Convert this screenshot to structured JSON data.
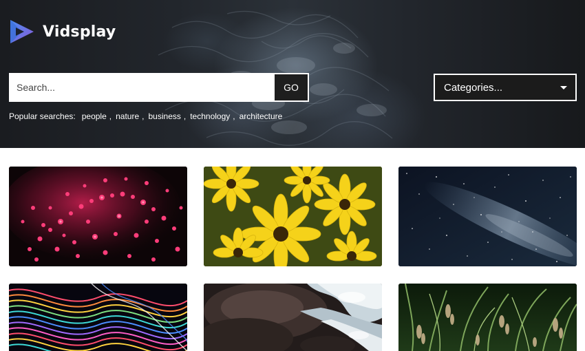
{
  "brand": {
    "name": "Vidsplay"
  },
  "search": {
    "placeholder": "Search...",
    "go_label": "GO"
  },
  "popular": {
    "label": "Popular searches:",
    "terms": [
      "people",
      "nature",
      "business",
      "technology",
      "architecture"
    ]
  },
  "categories": {
    "label": "Categories..."
  },
  "videos": [
    {
      "subject": "pink bokeh lights"
    },
    {
      "subject": "yellow flowers"
    },
    {
      "subject": "milky way night sky"
    },
    {
      "subject": "colorful abstract waves"
    },
    {
      "subject": "water over rocks"
    },
    {
      "subject": "tall grass"
    }
  ],
  "colors": {
    "logo_blue": "#3b6fe0",
    "logo_purple": "#8a5bd8",
    "button_dark": "#1e1e1e"
  }
}
